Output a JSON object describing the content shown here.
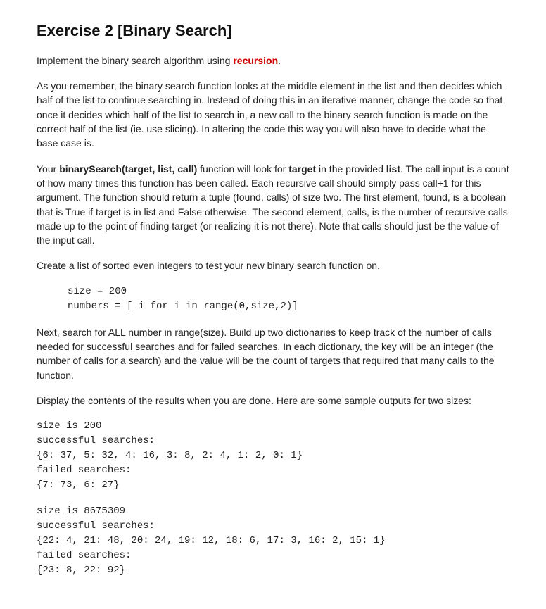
{
  "title": "Exercise 2 [Binary Search]",
  "intro": {
    "prefix": "Implement the binary search algorithm using ",
    "recursion": "recursion",
    "suffix": "."
  },
  "p1": "As you remember, the binary search function looks at the middle element in the list and then decides which half of the list to continue searching in. Instead of doing this in an iterative manner, change the code so that once it decides which half of the list to search in, a new call to the binary search function is made on the correct half of the list (ie. use slicing). In altering the code this way you will also have to decide what the base case is.",
  "p2": {
    "a": "Your ",
    "func": "binarySearch(target, list, call)",
    "b": " function will look for ",
    "target": "target",
    "c": " in the provided ",
    "list": "list",
    "d": ". The call input is a count of how many times this function has been called. Each recursive call should simply pass call+1 for this argument. The function should return a tuple (found, calls) of size two. The first element, found, is a boolean that is True if target is in list and False otherwise. The second element, calls, is the number of recursive calls made up to the point of finding target (or realizing it is not there). Note that calls should just be the value of the input call."
  },
  "p3": "Create a list of sorted even integers to test your new binary search function on.",
  "code1": "size = 200\nnumbers = [ i for i in range(0,size,2)]",
  "p4": "Next, search for ALL number in range(size). Build up two dictionaries to keep track of the number of calls needed for successful searches and for failed searches. In each dictionary, the key will be an integer (the number of calls for a search) and the value will be the count of targets that required that many calls to the function.",
  "p5": "Display the contents of the results when you are done.  Here are some sample outputs for two sizes:",
  "output1": "size is 200\nsuccessful searches:\n{6: 37, 5: 32, 4: 16, 3: 8, 2: 4, 1: 2, 0: 1}\nfailed searches:\n{7: 73, 6: 27}",
  "output2": "size is 8675309\nsuccessful searches:\n{22: 4, 21: 48, 20: 24, 19: 12, 18: 6, 17: 3, 16: 2, 15: 1}\nfailed searches:\n{23: 8, 22: 92}"
}
